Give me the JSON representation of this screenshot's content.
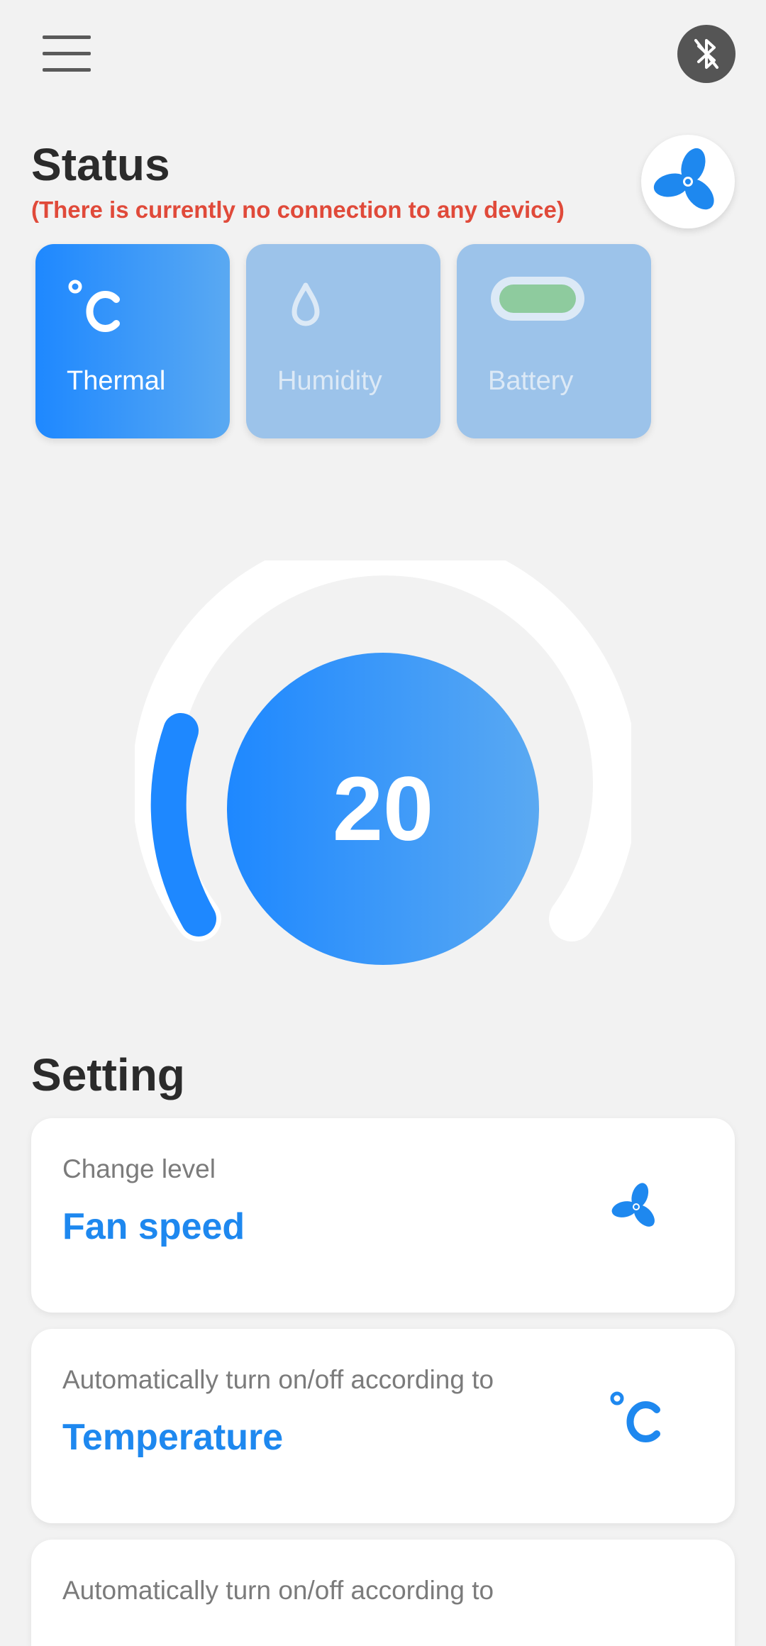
{
  "header": {
    "menu_icon": "hamburger-menu-icon",
    "bluetooth_icon": "bluetooth-disabled-icon",
    "status_title": "Status",
    "status_message": "(There is currently no connection to any device)",
    "fan_icon": "fan-icon"
  },
  "status_cards": [
    {
      "label": "Thermal",
      "icon": "celsius-icon",
      "active": true
    },
    {
      "label": "Humidity",
      "icon": "water-drop-icon",
      "active": false
    },
    {
      "label": "Battery",
      "icon": "battery-icon",
      "active": false
    }
  ],
  "dial": {
    "value": "20"
  },
  "settings": {
    "title": "Setting",
    "items": [
      {
        "subtitle": "Change level",
        "title": "Fan speed",
        "icon": "fan-icon"
      },
      {
        "subtitle": "Automatically turn on/off according to",
        "title": "Temperature",
        "icon": "celsius-icon"
      },
      {
        "subtitle": "Automatically turn on/off according to",
        "title": "",
        "icon": ""
      }
    ]
  },
  "colors": {
    "accent": "#1e88ff",
    "error": "#e04a3a",
    "background": "#f2f2f2",
    "inactive_card": "#9cc3ea",
    "battery_fill": "#8ecb9e"
  }
}
